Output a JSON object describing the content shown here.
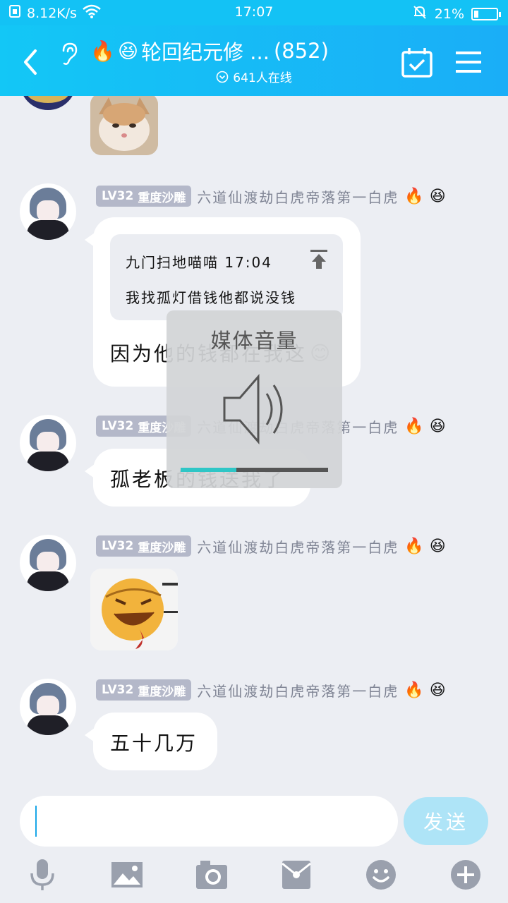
{
  "status_bar": {
    "speed": "8.12K/s",
    "time": "17:07",
    "battery": "21%",
    "battery_level": 0.21
  },
  "header": {
    "title": "轮回纪元修 ...",
    "count": "(852)",
    "title_emojis": [
      "🔥",
      "😆"
    ],
    "online": "641人在线"
  },
  "messages": [
    {
      "level": "LV32",
      "title": "重度沙雕",
      "nickname": "六道仙渡劫白虎帝落第一白虎",
      "quote_author": "九门扫地喵喵 17:04",
      "quote_text": "我找孤灯借钱他都说没钱",
      "text": "因为他的钱都在我这",
      "trailing_emoji": "😊"
    },
    {
      "level": "LV32",
      "title": "重度沙雕",
      "nickname": "六道仙渡劫白虎帝落第一白虎",
      "text": "孤老板的钱送我了"
    },
    {
      "level": "LV32",
      "title": "重度沙雕",
      "nickname": "六道仙渡劫白虎帝落第一白虎",
      "image": "laughing-emoji-sticker"
    },
    {
      "level": "LV32",
      "title": "重度沙雕",
      "nickname": "六道仙渡劫白虎帝落第一白虎",
      "text": "五十几万"
    }
  ],
  "badge_emojis": [
    "🔥",
    "😆"
  ],
  "volume_overlay": {
    "title": "媒体音量",
    "level": 0.38
  },
  "input": {
    "value": "",
    "send_label": "发送"
  },
  "toolbar_icons": [
    "mic-icon",
    "image-icon",
    "camera-icon",
    "red-packet-icon",
    "emoji-icon",
    "plus-icon"
  ],
  "colors": {
    "header": "#13c2f5",
    "send_button": "#aee4f7",
    "volume_fill": "#2fc6c6",
    "icon_gray": "#9aa0ad"
  }
}
